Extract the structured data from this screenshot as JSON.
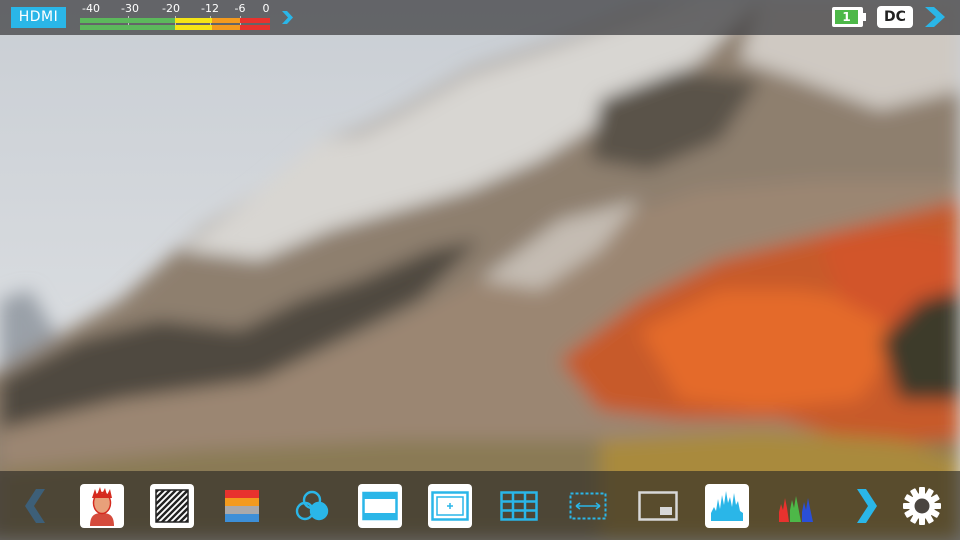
{
  "status_bar": {
    "input_label": "HDMI",
    "audio_meter": {
      "scale_labels": [
        "-40",
        "-30",
        "-20",
        "-12",
        "-6",
        "0"
      ],
      "colors": {
        "green": "#5cb85c",
        "yellow": "#f4e516",
        "orange": "#f39a1e",
        "red": "#e8322e"
      }
    },
    "battery_slot": "1",
    "power_label": "DC",
    "accent_color": "#2ab6e8"
  },
  "toolbar": {
    "prev_icon": "chevron-left-icon",
    "next_icon": "chevron-right-icon",
    "settings_icon": "gear-icon",
    "tools": [
      {
        "icon": "focus-peaking-icon"
      },
      {
        "icon": "zebra-icon"
      },
      {
        "icon": "false-color-icon"
      },
      {
        "icon": "color-channels-icon"
      },
      {
        "icon": "frame-guides-icon"
      },
      {
        "icon": "safe-area-icon"
      },
      {
        "icon": "grid-icon"
      },
      {
        "icon": "anamorphic-desqueeze-icon"
      },
      {
        "icon": "picture-in-picture-icon"
      },
      {
        "icon": "waveform-icon"
      },
      {
        "icon": "rgb-parade-icon"
      }
    ]
  }
}
